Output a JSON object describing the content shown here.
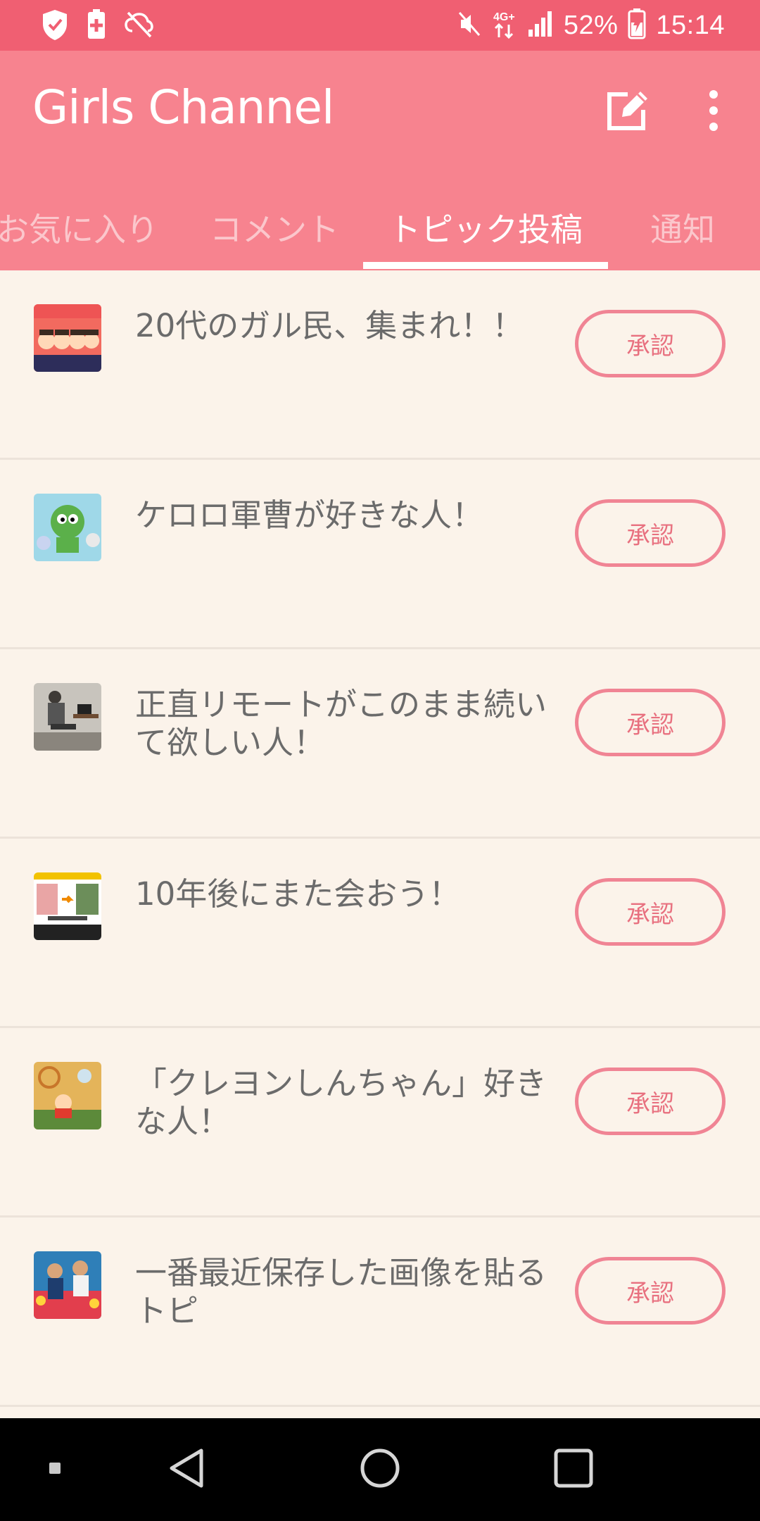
{
  "status_bar": {
    "battery_percent": "52%",
    "time": "15:14",
    "network_label": "4G+",
    "icons": [
      "shield-icon",
      "battery-saver-icon",
      "sync-off-icon",
      "mute-icon",
      "network-4g-icon",
      "signal-icon",
      "battery-icon"
    ]
  },
  "app_bar": {
    "title": "Girls Channel",
    "icons": [
      "edit-icon",
      "more-vert-icon"
    ]
  },
  "tabs": [
    {
      "label": "お気に入り",
      "active": false
    },
    {
      "label": "コメント",
      "active": false
    },
    {
      "label": "トピック投稿",
      "active": true
    },
    {
      "label": "通知",
      "active": false
    }
  ],
  "topics": [
    {
      "title": "20代のガル民、集まれ！！",
      "button": "承認"
    },
    {
      "title": "ケロロ軍曹が好きな人！",
      "button": "承認"
    },
    {
      "title": "正直リモートがこのまま続いて欲しい人！",
      "button": "承認"
    },
    {
      "title": "10年後にまた会おう！",
      "button": "承認"
    },
    {
      "title": "「クレヨンしんちゃん」好きな人！",
      "button": "承認"
    },
    {
      "title": "一番最近保存した画像を貼るトピ",
      "button": "承認"
    }
  ],
  "nav_bar": {
    "icons": [
      "recent-dot-icon",
      "back-icon",
      "home-icon",
      "overview-icon"
    ]
  },
  "colors": {
    "status_bar": "#f05f72",
    "app_bar": "#f7838f",
    "background": "#fbf3ea",
    "accent": "#f08494"
  }
}
